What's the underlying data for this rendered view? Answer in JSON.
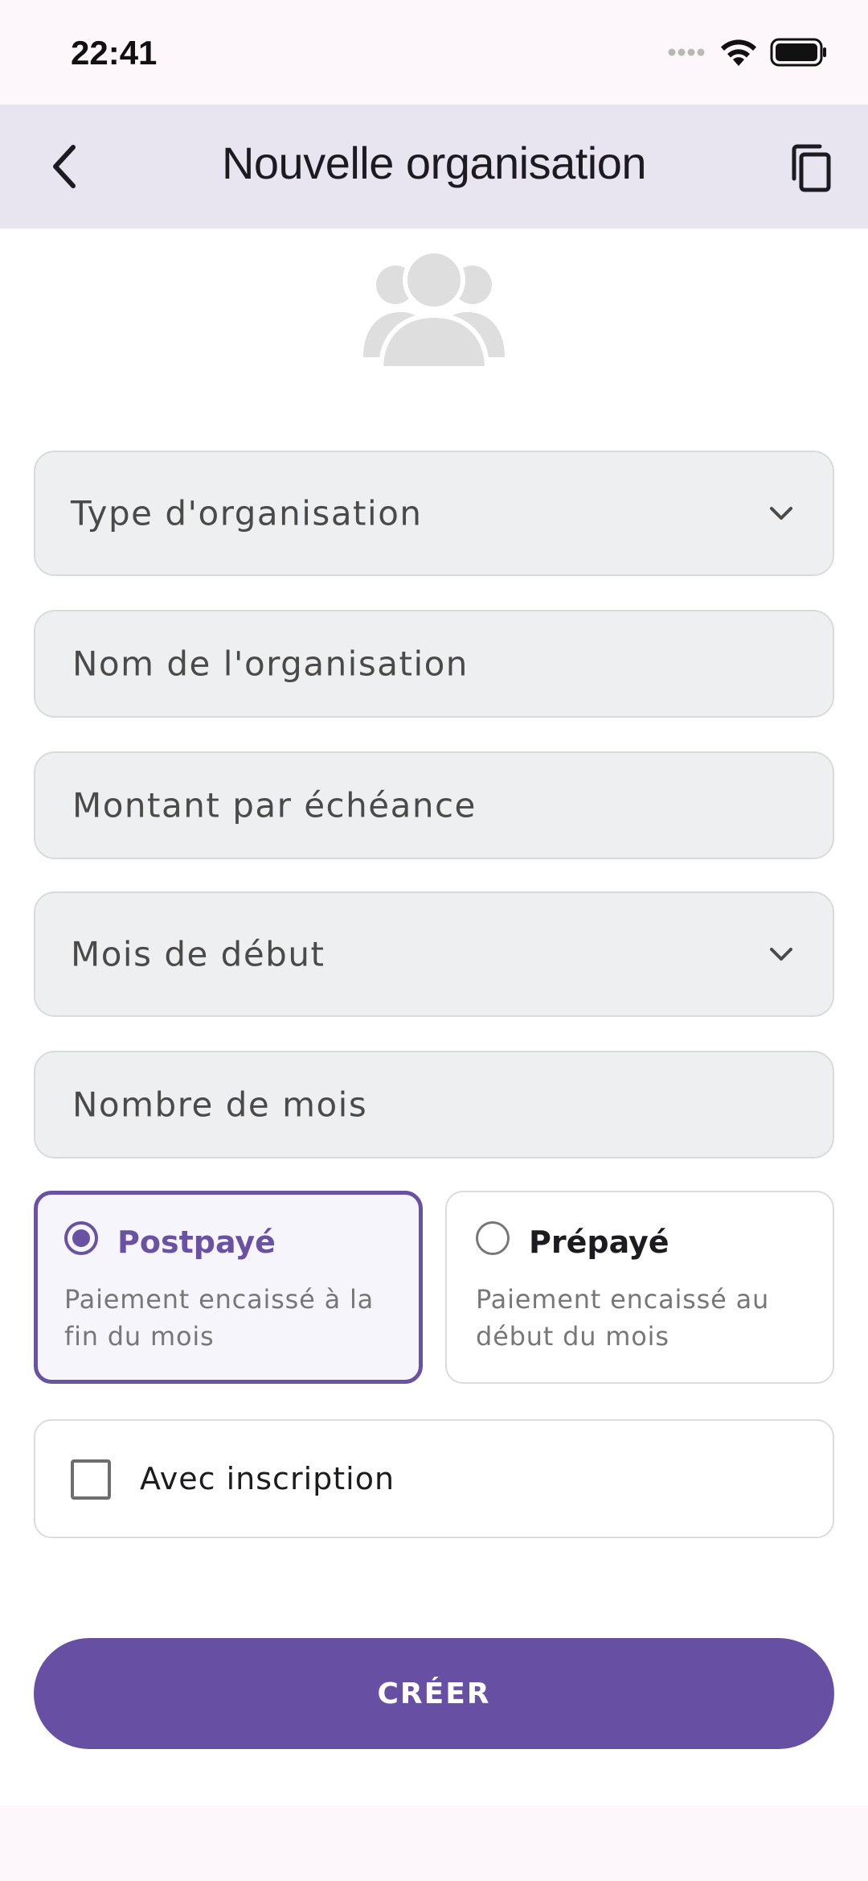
{
  "status_bar": {
    "time": "22:41"
  },
  "app_bar": {
    "title": "Nouvelle organisation"
  },
  "form": {
    "org_type_placeholder": "Type d'organisation",
    "org_name_placeholder": "Nom de l'organisation",
    "amount_placeholder": "Montant par échéance",
    "start_month_placeholder": "Mois de début",
    "months_count_placeholder": "Nombre de mois",
    "plans": [
      {
        "title": "Postpayé",
        "description": "Paiement encaissé à la fin du mois",
        "selected": true
      },
      {
        "title": "Prépayé",
        "description": "Paiement encaissé au début du mois",
        "selected": false
      }
    ],
    "registration_label": "Avec inscription",
    "registration_checked": false,
    "submit_label": "CRÉER"
  },
  "colors": {
    "accent": "#6750a4",
    "app_bar_bg": "#e8e4f0",
    "field_bg": "#edeff0"
  }
}
